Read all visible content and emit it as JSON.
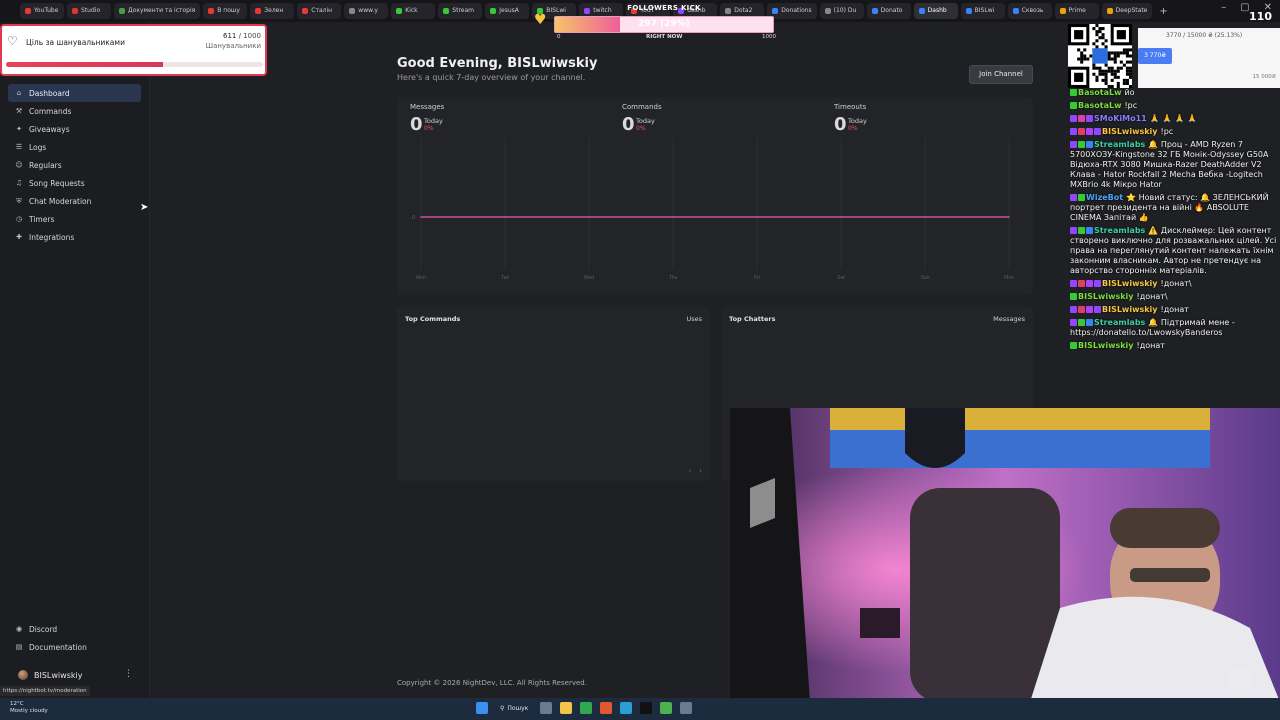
{
  "browser": {
    "tabs": [
      {
        "label": "YouTube",
        "color": "#e53935"
      },
      {
        "label": "Studio",
        "color": "#d33"
      },
      {
        "label": "Документи та історія",
        "color": "#43a047"
      },
      {
        "label": "В пошу",
        "color": "#e53935"
      },
      {
        "label": "Зелен",
        "color": "#e53935"
      },
      {
        "label": "Сталін",
        "color": "#e53935"
      },
      {
        "label": "www.y",
        "color": "#888"
      },
      {
        "label": "Kick",
        "color": "#3c3"
      },
      {
        "label": "Stream",
        "color": "#3c3"
      },
      {
        "label": "JesusA",
        "color": "#3c3"
      },
      {
        "label": "BISLwi",
        "color": "#3c3"
      },
      {
        "label": "twitch",
        "color": "#9146ff"
      },
      {
        "label": "YouT",
        "color": "#e53935"
      },
      {
        "label": "dashb",
        "color": "#9146ff"
      },
      {
        "label": "Dota2",
        "color": "#888"
      },
      {
        "label": "Donations",
        "color": "#3b82f6"
      },
      {
        "label": "(10) Du",
        "color": "#888"
      },
      {
        "label": "Donato",
        "color": "#3b82f6"
      },
      {
        "label": "Dashb",
        "color": "#3b82f6",
        "active": true
      },
      {
        "label": "BISLwi",
        "color": "#3b82f6"
      },
      {
        "label": "Сквозь",
        "color": "#3b82f6"
      },
      {
        "label": "Prime",
        "color": "#f59e0b"
      },
      {
        "label": "DeepState",
        "color": "#f59e0b"
      }
    ],
    "new_tab": "+",
    "url_hint": "https://nightbot.tv/moderation"
  },
  "goal_widget": {
    "title": "Ціль за шанувальниками",
    "count": "611",
    "total": "/ 1000",
    "subtitle": "Шанувальники",
    "progress": 0.611
  },
  "followers_kick": {
    "title": "FOLLOWERS KICK",
    "value": "297 (29%)",
    "min": "0",
    "now": "RIGHT NOW",
    "max": "1000",
    "progress": 0.297
  },
  "sidebar": {
    "items": [
      {
        "label": "Dashboard",
        "icon": "house-icon",
        "glyph": "⌂",
        "active": true
      },
      {
        "label": "Commands",
        "icon": "wand-icon",
        "glyph": "⚒"
      },
      {
        "label": "Giveaways",
        "icon": "gift-icon",
        "glyph": "✦"
      },
      {
        "label": "Logs",
        "icon": "list-icon",
        "glyph": "☰"
      },
      {
        "label": "Regulars",
        "icon": "users-icon",
        "glyph": "☺"
      },
      {
        "label": "Song Requests",
        "icon": "headphones-icon",
        "glyph": "♫"
      },
      {
        "label": "Chat Moderation",
        "icon": "shield-icon",
        "glyph": "⛨"
      },
      {
        "label": "Timers",
        "icon": "clock-icon",
        "glyph": "◷"
      },
      {
        "label": "Integrations",
        "icon": "puzzle-icon",
        "glyph": "✚"
      }
    ],
    "bottom_items": [
      {
        "label": "Discord",
        "icon": "discord-icon",
        "glyph": "◉"
      },
      {
        "label": "Documentation",
        "icon": "book-icon",
        "glyph": "▤"
      }
    ],
    "user": {
      "name": "BISLwiwskiy",
      "menu": "⋮"
    }
  },
  "main": {
    "greeting": "Good Evening, BISLwiwskiy",
    "subtitle": "Here's a quick 7-day overview of your channel.",
    "join_button": "Join Channel",
    "stats": [
      {
        "label": "Messages",
        "value": "0",
        "period": "Today",
        "change": "0%"
      },
      {
        "label": "Commands",
        "value": "0",
        "period": "Today",
        "change": "0%"
      },
      {
        "label": "Timeouts",
        "value": "0",
        "period": "Today",
        "change": "0%"
      }
    ],
    "chart_data": {
      "type": "line",
      "categories": [
        "Mon",
        "Tue",
        "Wed",
        "Thu",
        "Fri",
        "Sat",
        "Sun",
        "Mon"
      ],
      "ylabel_tick": "0",
      "series": [
        {
          "values": [
            0,
            0,
            0,
            0,
            0,
            0,
            0,
            0
          ],
          "color": "#c2569a"
        }
      ],
      "ylim": [
        0,
        1
      ]
    },
    "top_commands": {
      "title": "Top Commands",
      "right": "Uses",
      "prev": "‹",
      "next": "›"
    },
    "top_chatters": {
      "title": "Top Chatters",
      "right": "Messages"
    },
    "copyright": "Copyright © 2026 NightDev, LLC. All Rights Reserved."
  },
  "donation_widget": {
    "text": "3770 / 15000 ₴ (25.13%)",
    "pill": "3 770₴",
    "max": "15 000₴"
  },
  "overlay_counter": "110",
  "chat": [
    {
      "user": "BasotaLw",
      "color": "#7bdc3d",
      "text": "йо",
      "badges": [
        "#3c3"
      ]
    },
    {
      "user": "BasotaLw",
      "color": "#7bdc3d",
      "text": "!pc",
      "badges": [
        "#3c3"
      ]
    },
    {
      "user": "SMoKiMo11",
      "color": "#8a7cff",
      "text": "🙏 🙏 🙏 🙏",
      "badges": [
        "#9146ff",
        "#e040a0",
        "#9146ff"
      ]
    },
    {
      "user": "BISLwiwskiy",
      "color": "#f5c542",
      "text": "!pc",
      "badges": [
        "#9146ff",
        "#e04060",
        "#b040ff",
        "#9146ff"
      ]
    },
    {
      "user": "Streamlabs",
      "color": "#3ccfa0",
      "text": "🔔 Проц - AMD Ryzen 7 5700XОЗУ-Kingstone 32 ГБ Монік-Odyssey G50A Відюха-RTX 3080 Мишка-Razer DeathAdder V2 Клава - Hator Rockfall 2 Mecha Вебка -Logitech MXBrio 4k Мікро Hator",
      "badges": [
        "#9146ff",
        "#3c3",
        "#3b82f6"
      ]
    },
    {
      "user": "WizeBot",
      "color": "#4aa3ff",
      "text": "⭐ Новий статус: 🔔 ЗЕЛЕНСЬКИЙ портрет президента на війні 🔥 ABSOLUTE CINEMA Запітай 👍",
      "badges": [
        "#9146ff",
        "#3c3"
      ]
    },
    {
      "user": "Streamlabs",
      "color": "#3ccfa0",
      "text": "⚠️ Дисклеймер: Цей контент створено виключно для розважальних цілей. Усі права на переглянутий контент належать їхнім законним власникам. Автор не претендує на авторство сторонніх матеріалів.",
      "badges": [
        "#9146ff",
        "#3c3",
        "#3b82f6"
      ]
    },
    {
      "user": "BISLwiwskiy",
      "color": "#f5c542",
      "text": "!донат\\",
      "badges": [
        "#9146ff",
        "#e04060",
        "#b040ff",
        "#9146ff"
      ]
    },
    {
      "user": "BISLwiwskiy",
      "color": "#7bdc3d",
      "text": "!донат\\",
      "badges": [
        "#3c3"
      ]
    },
    {
      "user": "BISLwiwskiy",
      "color": "#f5c542",
      "text": "!донат",
      "badges": [
        "#9146ff",
        "#e04060",
        "#b040ff",
        "#9146ff"
      ]
    },
    {
      "user": "Streamlabs",
      "color": "#3ccfa0",
      "text": "🔔 Підтримай мене - https://donatello.to/LwowskyBanderos",
      "badges": [
        "#9146ff",
        "#3c3",
        "#3b82f6"
      ]
    },
    {
      "user": "BISLwiwskiy",
      "color": "#7bdc3d",
      "text": "!донат",
      "badges": [
        "#3c3"
      ]
    }
  ],
  "taskbar": {
    "weather_temp": "12°C",
    "weather_desc": "Mostly cloudy",
    "search": "Пошук"
  }
}
